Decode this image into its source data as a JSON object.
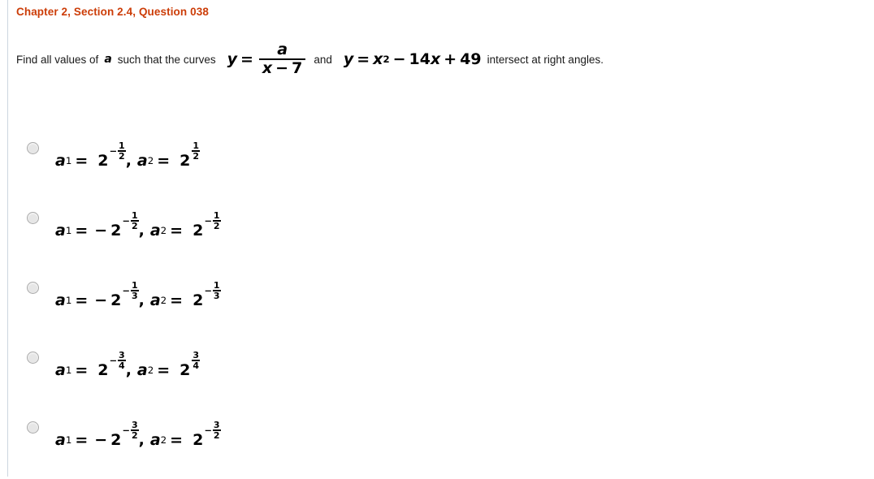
{
  "header": {
    "title": "Chapter 2, Section 2.4, Question 038",
    "color": "#cc3d08"
  },
  "prompt": {
    "lead": "Find all values of",
    "variable": "a",
    "middle": "such that the curves",
    "equation_1": {
      "lhs": "y",
      "equals": "=",
      "numerator": "a",
      "denominator_var": "x",
      "denominator_op": "−",
      "denominator_num": "7"
    },
    "conjunction": "and",
    "equation_2": {
      "lhs": "y",
      "equals": "=",
      "term1_base": "x",
      "term1_exp": "2",
      "op1": "−",
      "term2": "14",
      "term2_var": "x",
      "op2": "+",
      "term3": "49"
    },
    "tail": "intersect at right angles."
  },
  "options": [
    {
      "id": "option-1",
      "selected": false,
      "a1": {
        "label": "a",
        "index": "1",
        "equals": "=",
        "sign": "",
        "base": "2",
        "exp_sign": "−",
        "exp_num": "1",
        "exp_den": "2"
      },
      "a2": {
        "label": "a",
        "index": "2",
        "equals": "=",
        "sign": "",
        "base": "2",
        "exp_sign": "",
        "exp_num": "1",
        "exp_den": "2"
      },
      "separator": ","
    },
    {
      "id": "option-2",
      "selected": false,
      "a1": {
        "label": "a",
        "index": "1",
        "equals": "=",
        "sign": "−",
        "base": "2",
        "exp_sign": "−",
        "exp_num": "1",
        "exp_den": "2"
      },
      "a2": {
        "label": "a",
        "index": "2",
        "equals": "=",
        "sign": "",
        "base": "2",
        "exp_sign": "−",
        "exp_num": "1",
        "exp_den": "2"
      },
      "separator": ","
    },
    {
      "id": "option-3",
      "selected": false,
      "a1": {
        "label": "a",
        "index": "1",
        "equals": "=",
        "sign": "−",
        "base": "2",
        "exp_sign": "−",
        "exp_num": "1",
        "exp_den": "3"
      },
      "a2": {
        "label": "a",
        "index": "2",
        "equals": "=",
        "sign": "",
        "base": "2",
        "exp_sign": "−",
        "exp_num": "1",
        "exp_den": "3"
      },
      "separator": ","
    },
    {
      "id": "option-4",
      "selected": false,
      "a1": {
        "label": "a",
        "index": "1",
        "equals": "=",
        "sign": "",
        "base": "2",
        "exp_sign": "−",
        "exp_num": "3",
        "exp_den": "4"
      },
      "a2": {
        "label": "a",
        "index": "2",
        "equals": "=",
        "sign": "",
        "base": "2",
        "exp_sign": "",
        "exp_num": "3",
        "exp_den": "4"
      },
      "separator": ","
    },
    {
      "id": "option-5",
      "selected": false,
      "a1": {
        "label": "a",
        "index": "1",
        "equals": "=",
        "sign": "−",
        "base": "2",
        "exp_sign": "−",
        "exp_num": "3",
        "exp_den": "2"
      },
      "a2": {
        "label": "a",
        "index": "2",
        "equals": "=",
        "sign": "",
        "base": "2",
        "exp_sign": "−",
        "exp_num": "3",
        "exp_den": "2"
      },
      "separator": ","
    }
  ]
}
